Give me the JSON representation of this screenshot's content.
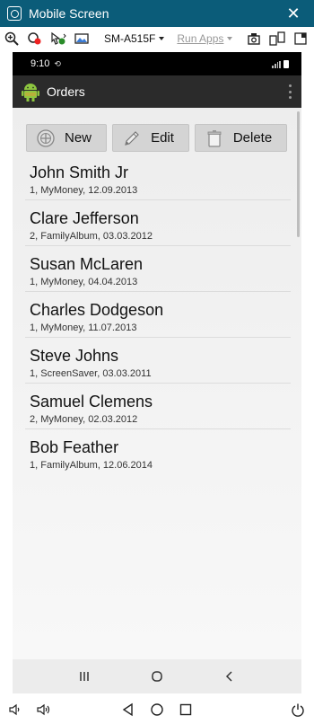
{
  "window": {
    "title": "Mobile Screen",
    "close_glyph": "✕"
  },
  "toolbar": {
    "device": "SM-A515F",
    "run_apps": "Run Apps"
  },
  "status": {
    "time": "9:10",
    "sync_glyph": "⟲"
  },
  "app": {
    "title": "Orders",
    "buttons": {
      "new": "New",
      "edit": "Edit",
      "delete": "Delete"
    }
  },
  "orders": [
    {
      "name": "John Smith Jr",
      "detail": "1, MyMoney, 12.09.2013"
    },
    {
      "name": "Clare Jefferson",
      "detail": "2, FamilyAlbum, 03.03.2012"
    },
    {
      "name": "Susan McLaren",
      "detail": "1, MyMoney, 04.04.2013"
    },
    {
      "name": "Charles Dodgeson",
      "detail": "1, MyMoney, 11.07.2013"
    },
    {
      "name": "Steve Johns",
      "detail": "1, ScreenSaver, 03.03.2011"
    },
    {
      "name": "Samuel Clemens",
      "detail": "2, MyMoney, 02.03.2012"
    },
    {
      "name": "Bob Feather",
      "detail": "1, FamilyAlbum, 12.06.2014"
    }
  ],
  "icons": {
    "titlebar": "app-icon",
    "toolbar": [
      "zoom-icon",
      "record-icon",
      "pointer-icon",
      "image-icon",
      "screenshot-icon",
      "rotate-icon",
      "window-icon"
    ],
    "android_nav": [
      "recents-icon",
      "home-icon",
      "back-icon"
    ],
    "bottom": [
      "volume-down-icon",
      "volume-up-icon",
      "back-icon",
      "home-icon",
      "overview-icon",
      "power-icon"
    ]
  },
  "colors": {
    "titlebar": "#0b5c79",
    "actionbar": "#2b2b2b",
    "android_icon": "#8dc63f"
  }
}
